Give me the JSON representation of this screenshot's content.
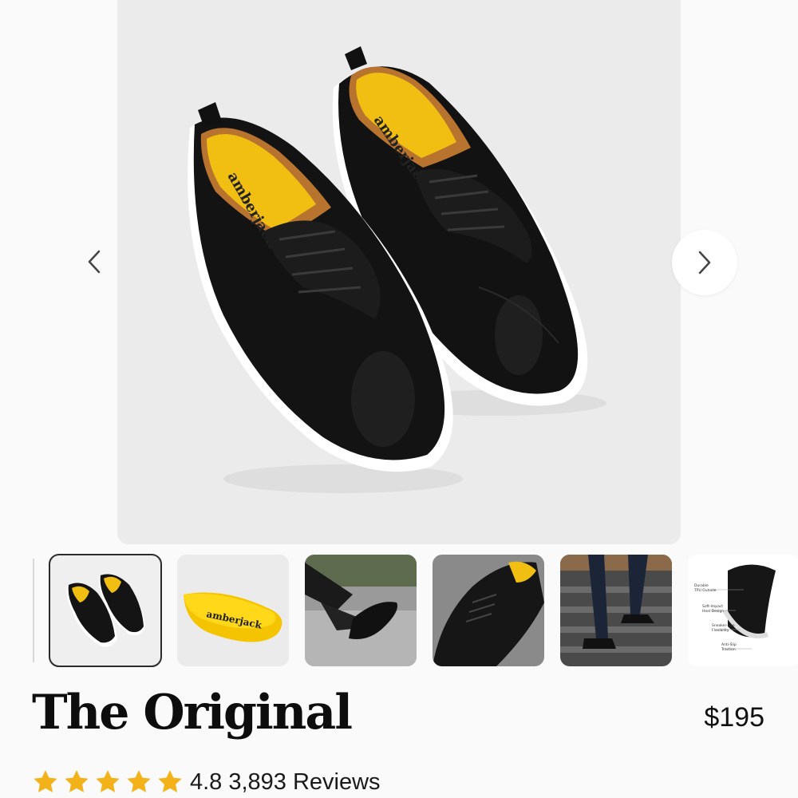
{
  "gallery": {
    "main_image": {
      "subject": "pair-of-black-leather-derby-shoes",
      "insole_brand_text": "amberjack"
    },
    "prev_icon": "chevron-left-icon",
    "next_icon": "chevron-right-icon",
    "thumbnails": [
      {
        "subject": "pair-of-black-shoes-top-view",
        "active": true
      },
      {
        "subject": "yellow-insole",
        "text": "amberjack",
        "active": false
      },
      {
        "subject": "person-wearing-shoes-on-steps",
        "active": false
      },
      {
        "subject": "shoe-closeup",
        "active": false
      },
      {
        "subject": "person-climbing-stairs",
        "active": false
      },
      {
        "subject": "sole-feature-diagram",
        "active": false,
        "callouts": [
          "Durable TPU Outsole",
          "Soft-Impact Heel Design",
          "Sneaker-Like Flexibility",
          "Anti-Slip Traction"
        ]
      }
    ]
  },
  "product": {
    "title": "The Original",
    "price": "$195",
    "rating": 4.8,
    "rating_text": "4.8",
    "reviews_text": "3,893 Reviews",
    "star_color": "#f3b219"
  }
}
